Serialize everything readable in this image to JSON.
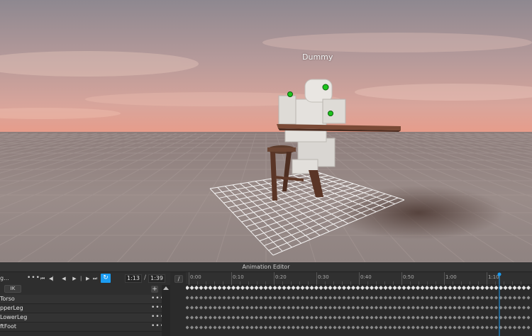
{
  "viewport": {
    "model_label": "Dummy"
  },
  "editor": {
    "title": "Animation Editor",
    "animation_name": "g...",
    "current_time": "1:13",
    "time_separator": "/",
    "end_time": "1:39",
    "ik_label": "IK",
    "add_label": "+",
    "more_label": "•••",
    "playback_icons": [
      "skip-to-start-icon",
      "previous-keyframe-icon",
      "play-reverse-icon",
      "play-icon",
      "next-keyframe-icon",
      "skip-to-end-icon",
      "loop-icon"
    ],
    "tracks": [
      {
        "name": "Torso"
      },
      {
        "name": "pperLeg"
      },
      {
        "name": "LowerLeg"
      },
      {
        "name": "ftFoot"
      }
    ],
    "ruler_ticks": [
      "0:00",
      "0:10",
      "0:20",
      "0:30",
      "0:40",
      "0:50",
      "1:00",
      "1:10"
    ],
    "ruler_tick_seconds": [
      0,
      10,
      20,
      30,
      40,
      50,
      60,
      70
    ],
    "scrubber_seconds": 73,
    "accent_color": "#1b9cf2"
  }
}
